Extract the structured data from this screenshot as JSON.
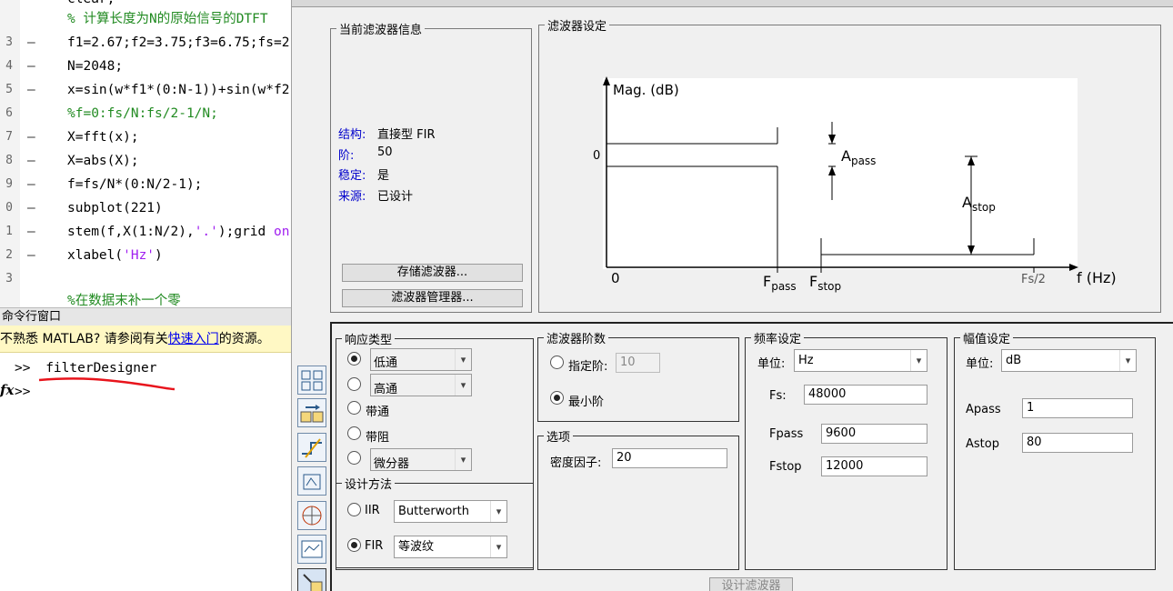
{
  "editor": {
    "partial_top_line": "clear;",
    "lines": [
      {
        "n": "",
        "code": "% 计算长度为N的原始信号的DTFT",
        "type": "comment"
      },
      {
        "n": "3",
        "code": "f1=2.67;f2=3.75;f3=6.75;fs=2",
        "type": "code"
      },
      {
        "n": "4",
        "code": "N=2048;",
        "type": "code"
      },
      {
        "n": "5",
        "code": "x=sin(w*f1*(0:N-1))+sin(w*f2",
        "type": "code"
      },
      {
        "n": "6",
        "code": "%f=0:fs/N:fs/2-1/N;",
        "type": "comment"
      },
      {
        "n": "7",
        "code": "X=fft(x);",
        "type": "code"
      },
      {
        "n": "8",
        "code": "X=abs(X);",
        "type": "code"
      },
      {
        "n": "9",
        "code": "f=fs/N*(0:N/2-1);",
        "type": "code"
      },
      {
        "n": "0",
        "code": "subplot(221)",
        "type": "code"
      },
      {
        "n": "1",
        "code_pre": "stem(f,X(1:N/2),",
        "code_str": "'.'",
        "code_post": ");grid ",
        "code_kw": "on",
        "type": "mixed"
      },
      {
        "n": "2",
        "code_pre": "xlabel(",
        "code_str": "'Hz'",
        "code_post": ")",
        "type": "mixed"
      },
      {
        "n": "3",
        "code": "",
        "type": "code"
      },
      {
        "n": "",
        "code": "%在数据末补一个零",
        "type": "comment"
      }
    ]
  },
  "command_window": {
    "title": "命令行窗口",
    "notice_pre": "不熟悉 MATLAB? 请参阅有关",
    "notice_link": "快速入门",
    "notice_post": "的资源。",
    "prompt": ">>",
    "command": "filterDesigner",
    "fx_symbol": "fx"
  },
  "filter_info": {
    "legend": "当前滤波器信息",
    "rows": [
      {
        "label": "结构:",
        "value": "直接型 FIR"
      },
      {
        "label": "阶:",
        "value": "50"
      },
      {
        "label": "稳定:",
        "value": "是"
      },
      {
        "label": "来源:",
        "value": "已设计"
      }
    ],
    "store_button": "存储滤波器...",
    "manager_button": "滤波器管理器..."
  },
  "filter_spec": {
    "legend": "滤波器设定",
    "plot": {
      "ylabel": "Mag. (dB)",
      "xlabel": "f (Hz)",
      "zero_y": "0",
      "zero_x": "0",
      "fpass_main": "F",
      "fpass_sub": "pass",
      "fstop_main": "F",
      "fstop_sub": "stop",
      "apass_main": "A",
      "apass_sub": "pass",
      "astop_main": "A",
      "astop_sub": "stop",
      "fs2": "Fs/2"
    }
  },
  "response_type": {
    "legend": "响应类型",
    "options": [
      {
        "label": "低通",
        "checked": true,
        "has_select": true
      },
      {
        "label": "高通",
        "checked": false,
        "has_select": true
      },
      {
        "label": "带通",
        "checked": false,
        "has_select": false
      },
      {
        "label": "带阻",
        "checked": false,
        "has_select": false
      },
      {
        "label": "微分器",
        "checked": false,
        "has_select": true
      }
    ]
  },
  "design_method": {
    "legend": "设计方法",
    "iir_label": "IIR",
    "iir_value": "Butterworth",
    "fir_label": "FIR",
    "fir_value": "等波纹",
    "selected": "FIR"
  },
  "filter_order": {
    "legend": "滤波器阶数",
    "specify_label": "指定阶:",
    "specify_value": "10",
    "min_label": "最小阶",
    "selected": "最小阶"
  },
  "options": {
    "legend": "选项",
    "density_label": "密度因子:",
    "density_value": "20"
  },
  "freq_spec": {
    "legend": "频率设定",
    "unit_label": "单位:",
    "unit_value": "Hz",
    "fs_label": "Fs:",
    "fs_value": "48000",
    "fpass_label": "Fpass",
    "fpass_value": "9600",
    "fstop_label": "Fstop",
    "fstop_value": "12000"
  },
  "mag_spec": {
    "legend": "幅值设定",
    "unit_label": "单位:",
    "unit_value": "dB",
    "apass_label": "Apass",
    "apass_value": "1",
    "astop_label": "Astop",
    "astop_value": "80"
  },
  "design_button": "设计滤波器",
  "colors": {
    "annotation_red": "#e8141c",
    "link_blue": "#0000ee",
    "label_blue": "#0000cc"
  }
}
